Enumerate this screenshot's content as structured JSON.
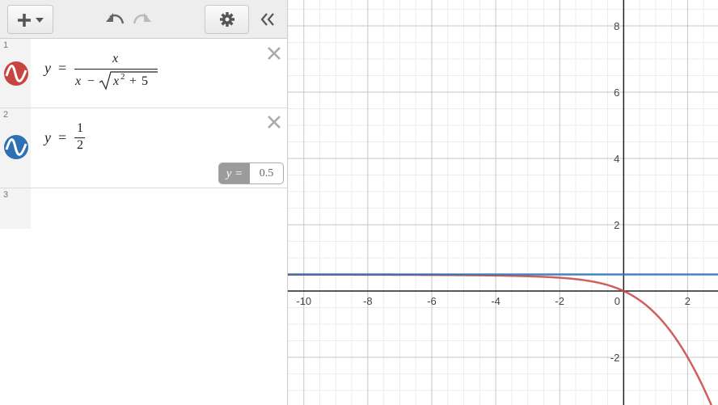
{
  "toolbar": {
    "add_icon": "plus-icon",
    "dropdown_icon": "caret-down-icon",
    "undo_icon": "undo-icon",
    "redo_icon": "redo-icon",
    "settings_icon": "gear-icon",
    "collapse_icon": "double-chevron-left-icon"
  },
  "expressions": [
    {
      "index": "1",
      "color": "#c74440",
      "latex": "y = x / (x - sqrt(x^2 + 5))",
      "lhs": "y",
      "eq": "=",
      "numerator": "x",
      "den_x": "x",
      "den_minus": "−",
      "radicand_x": "x",
      "radicand_exp": "2",
      "radicand_plus": "+",
      "radicand_const": "5"
    },
    {
      "index": "2",
      "color": "#2d70b3",
      "latex": "y = 1/2",
      "lhs": "y",
      "eq": "=",
      "numerator": "1",
      "denominator": "2",
      "evaluation_label": "y =",
      "evaluation_value": "0.5"
    },
    {
      "index": "3"
    }
  ],
  "graph": {
    "x_ticks": [
      "-10",
      "-8",
      "-6",
      "-4",
      "-2",
      "0",
      "2"
    ],
    "y_ticks": [
      "8",
      "6",
      "4",
      "2",
      "-2"
    ],
    "xlim": [
      -10.5,
      2.95
    ],
    "ylim": [
      -3.44,
      8.78
    ],
    "grid": true,
    "series": [
      {
        "expr": "x/(x-sqrt(x^2+5))",
        "color": "#c74440"
      },
      {
        "expr": "0.5",
        "color": "#2d70b3"
      }
    ]
  }
}
